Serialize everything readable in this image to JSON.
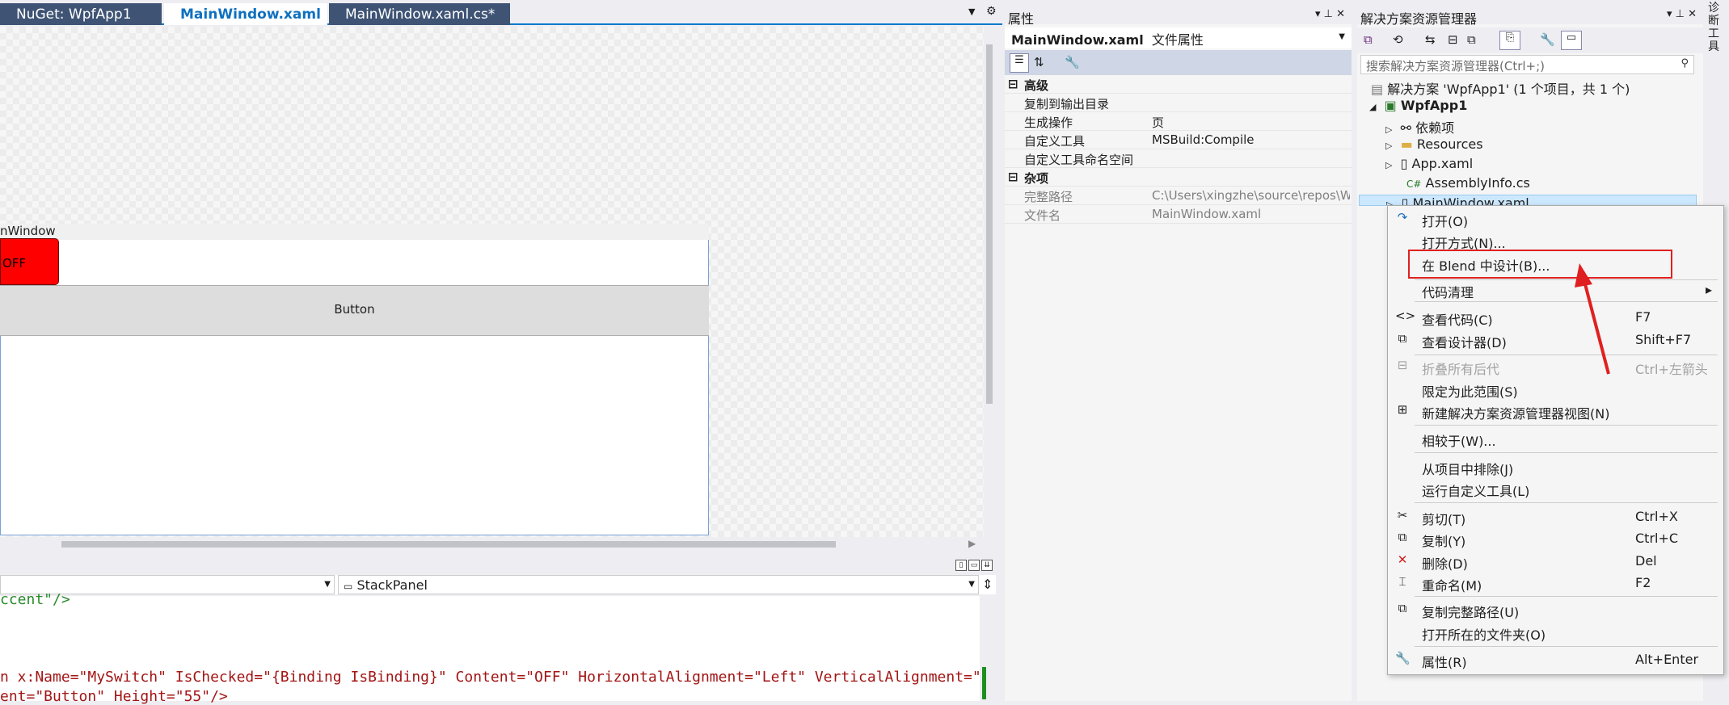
{
  "tabs": [
    {
      "label": "NuGet: WpfApp1"
    },
    {
      "label": "MainWindow.xaml",
      "pin": "⊣",
      "close": "✕"
    },
    {
      "label": "MainWindow.xaml.cs*"
    }
  ],
  "designer": {
    "window_title": "nWindow",
    "switch_label": "OFF",
    "button_label": "Button"
  },
  "navbar": {
    "left_combo": "",
    "right_combo": "StackPanel"
  },
  "code": {
    "line1": "ccent\"/>",
    "line2": "n x:Name=\"MySwitch\" IsChecked=\"{Binding IsBinding}\" Content=\"OFF\" HorizontalAlignment=\"Left\" VerticalAlignment=\"",
    "line3": "ent=\"Button\" Height=\"55\"/>"
  },
  "properties": {
    "title": "属性",
    "file_name": "MainWindow.xaml",
    "file_type": "文件属性",
    "cat_advanced": "高级",
    "cat_misc": "杂项",
    "rows": [
      {
        "key": "复制到输出目录",
        "value": ""
      },
      {
        "key": "生成操作",
        "value": "页"
      },
      {
        "key": "自定义工具",
        "value": "MSBuild:Compile"
      },
      {
        "key": "自定义工具命名空间",
        "value": ""
      }
    ],
    "misc_rows": [
      {
        "key": "完整路径",
        "value": "C:\\Users\\xingzhe\\source\\repos\\W"
      },
      {
        "key": "文件名",
        "value": "MainWindow.xaml"
      }
    ]
  },
  "solution": {
    "title": "解决方案资源管理器",
    "search_placeholder": "搜索解决方案资源管理器(Ctrl+;)",
    "strip_label": "诊断工具",
    "items": [
      {
        "label": "解决方案 'WpfApp1' (1 个项目，共 1 个)"
      },
      {
        "label": "WpfApp1"
      },
      {
        "label": "依赖项"
      },
      {
        "label": "Resources"
      },
      {
        "label": "App.xaml"
      },
      {
        "label": "AssemblyInfo.cs"
      },
      {
        "label": "MainWindow.xaml"
      }
    ]
  },
  "menu": [
    {
      "label": "打开(O)",
      "shortcut": ""
    },
    {
      "label": "打开方式(N)...",
      "shortcut": ""
    },
    {
      "label": "在 Blend 中设计(B)...",
      "shortcut": ""
    },
    {
      "label": "代码清理",
      "shortcut": "▸"
    },
    {
      "label": "查看代码(C)",
      "shortcut": "F7"
    },
    {
      "label": "查看设计器(D)",
      "shortcut": "Shift+F7"
    },
    {
      "label": "折叠所有后代",
      "shortcut": "Ctrl+左箭头"
    },
    {
      "label": "限定为此范围(S)",
      "shortcut": ""
    },
    {
      "label": "新建解决方案资源管理器视图(N)",
      "shortcut": ""
    },
    {
      "label": "相较于(W)...",
      "shortcut": ""
    },
    {
      "label": "从项目中排除(J)",
      "shortcut": ""
    },
    {
      "label": "运行自定义工具(L)",
      "shortcut": ""
    },
    {
      "label": "剪切(T)",
      "shortcut": "Ctrl+X"
    },
    {
      "label": "复制(Y)",
      "shortcut": "Ctrl+C"
    },
    {
      "label": "删除(D)",
      "shortcut": "Del"
    },
    {
      "label": "重命名(M)",
      "shortcut": "F2"
    },
    {
      "label": "复制完整路径(U)",
      "shortcut": ""
    },
    {
      "label": "打开所在的文件夹(O)",
      "shortcut": ""
    },
    {
      "label": "属性(R)",
      "shortcut": "Alt+Enter"
    }
  ],
  "colors": {
    "accent": "#007acc",
    "highlight": "#e02020"
  }
}
